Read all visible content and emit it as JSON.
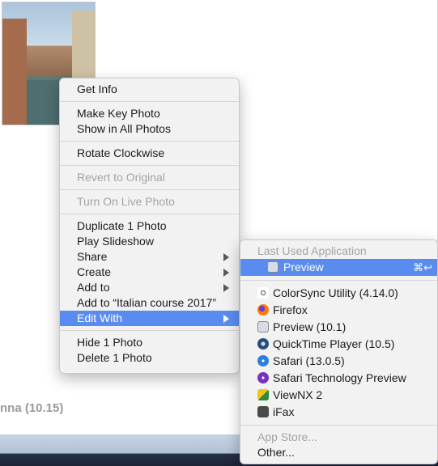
{
  "background": {
    "caption": "nna (10.15)"
  },
  "context_menu": {
    "groups": [
      [
        "Get Info"
      ],
      [
        "Make Key Photo",
        "Show in All Photos"
      ],
      [
        "Rotate Clockwise"
      ],
      [
        "Revert to Original"
      ],
      [
        "Turn On Live Photo"
      ],
      [
        "Duplicate 1 Photo",
        "Play Slideshow",
        "Share",
        "Create",
        "Add to",
        "Add to “Italian course 2017”",
        "Edit With"
      ],
      [
        "Hide 1 Photo",
        "Delete 1 Photo"
      ]
    ],
    "items": {
      "get_info": "Get Info",
      "make_key_photo": "Make Key Photo",
      "show_in_all_photos": "Show in All Photos",
      "rotate_clockwise": "Rotate Clockwise",
      "revert_to_original": "Revert to Original",
      "turn_on_live_photo": "Turn On Live Photo",
      "duplicate": "Duplicate 1 Photo",
      "play_slideshow": "Play Slideshow",
      "share": "Share",
      "create": "Create",
      "add_to": "Add to",
      "add_to_album": "Add to “Italian course 2017”",
      "edit_with": "Edit With",
      "hide": "Hide 1 Photo",
      "delete": "Delete 1 Photo"
    },
    "selected": "Edit With",
    "disabled": [
      "Revert to Original",
      "Turn On Live Photo"
    ]
  },
  "submenu": {
    "header": "Last Used Application",
    "last_used": {
      "label": "Preview",
      "shortcut": "⌘↩",
      "icon": "preview-icon"
    },
    "apps": [
      {
        "label": "ColorSync Utility (4.14.0)",
        "icon": "colorsync-icon"
      },
      {
        "label": "Firefox",
        "icon": "firefox-icon"
      },
      {
        "label": "Preview (10.1)",
        "icon": "preview-icon"
      },
      {
        "label": "QuickTime Player (10.5)",
        "icon": "quicktime-icon"
      },
      {
        "label": "Safari (13.0.5)",
        "icon": "safari-icon"
      },
      {
        "label": "Safari Technology Preview",
        "icon": "safari-technology-preview-icon"
      },
      {
        "label": "ViewNX 2",
        "icon": "viewnx-icon"
      },
      {
        "label": "iFax",
        "icon": "ifax-icon"
      }
    ],
    "app_store": "App Store...",
    "other": "Other..."
  },
  "colors": {
    "selection": "#5a8cf0",
    "menu_background": "#f2f2f2",
    "disabled_text": "#a4a4a4"
  }
}
